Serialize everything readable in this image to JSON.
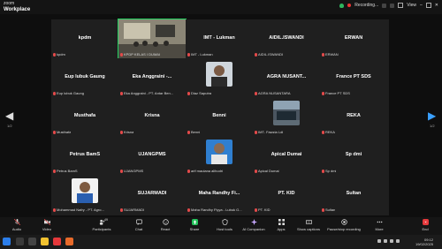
{
  "app": {
    "brand_top": "zoom",
    "brand_bottom": "Workplace"
  },
  "topbar": {
    "recording": "Recording...",
    "view": "View"
  },
  "tiles": [
    {
      "big": "kpdm",
      "small": "kpdm"
    },
    {
      "big": "",
      "small": "KPDP KELAS I DUMAI"
    },
    {
      "big": "IMT - Lukman",
      "small": "IMT - Lukman"
    },
    {
      "big": "AIDIL.ISWANDI",
      "small": "AIDIL.ISWANDI"
    },
    {
      "big": "ERWAN",
      "small": "ERWAN"
    },
    {
      "big": "Eup lubuk Gaung",
      "small": "Eup lubuk Gaung"
    },
    {
      "big": "Eka Anggraini -...",
      "small": "Eka Anggraini - PT. Antar Ben..."
    },
    {
      "big": "",
      "small": "Diaz Saputra"
    },
    {
      "big": "AGRA NUSANT...",
      "small": "AGRA NUSANTARA"
    },
    {
      "big": "France PT SDS",
      "small": "France PT SDS"
    },
    {
      "big": "Musthafa",
      "small": "Musthafa"
    },
    {
      "big": "Krisna",
      "small": "Krisna"
    },
    {
      "big": "Benni",
      "small": "Benni"
    },
    {
      "big": "",
      "small": "IMT- Fawzia Ldi"
    },
    {
      "big": "REKA",
      "small": "REKA"
    },
    {
      "big": "Petrus BamS",
      "small": "Petrus BamS"
    },
    {
      "big": "UJANGPMS",
      "small": "UJANGPMS"
    },
    {
      "big": "",
      "small": "arif maulana alihodri"
    },
    {
      "big": "Apical Dumai",
      "small": "Apical Dumai"
    },
    {
      "big": "Sp dmi",
      "small": "Sp dmi"
    },
    {
      "big": "",
      "small": "Mohammad Nafry - PT. Agro..."
    },
    {
      "big": "SUJARMADI",
      "small": "SUJARMADI"
    },
    {
      "big": "Maha Randhy Fi...",
      "small": "Maha Randhy Fiyya - Lubuk G..."
    },
    {
      "big": "PT. KID",
      "small": "PT. KID"
    },
    {
      "big": "Sultan",
      "small": "Sultan"
    }
  ],
  "pager": {
    "left": "1/2",
    "right": "1/2"
  },
  "toolbar": {
    "audio": "Audio",
    "video": "Video",
    "participants": "Participants",
    "participants_count": "49",
    "chat": "Chat",
    "react": "React",
    "share": "Share",
    "host_tools": "Host tools",
    "ai": "AI Companion",
    "apps": "Apps",
    "captions": "Show captions",
    "record": "Pause/stop recording",
    "more": "More",
    "end": "End"
  },
  "taskbar": {
    "time": "09:12",
    "date": "19/02/2025"
  },
  "colors": {
    "active_border": "#23d160",
    "mic_muted": "#e34a4a",
    "end_button": "#e5383b"
  }
}
